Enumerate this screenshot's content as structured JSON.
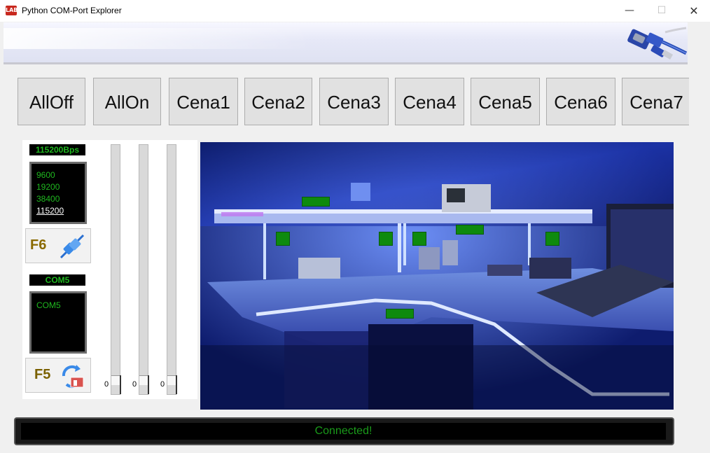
{
  "window": {
    "title": "Python COM-Port Explorer",
    "app_icon_text": "LAB",
    "minimize": "—",
    "maximize": "☐",
    "close": "✕"
  },
  "scenes": [
    "AllOff",
    "AllOn",
    "Cena1",
    "Cena2",
    "Cena3",
    "Cena4",
    "Cena5",
    "Cena6",
    "Cena7"
  ],
  "baud": {
    "label": "115200Bps",
    "options": [
      "9600",
      "19200",
      "38400",
      "115200"
    ],
    "selected": "115200"
  },
  "f6_button": {
    "label": "F6",
    "icon": "connect-plug-icon"
  },
  "com": {
    "label": "COM5",
    "options": [
      "COM5"
    ]
  },
  "f5_button": {
    "label": "F5",
    "icon": "refresh-icon"
  },
  "sliders": [
    {
      "value": "0"
    },
    {
      "value": "0"
    },
    {
      "value": "0"
    }
  ],
  "status": {
    "text": "Connected!"
  },
  "colors": {
    "terminal_green": "#1fb81f",
    "button_green": "#0e8a0e",
    "status_green": "#1a9a1a"
  }
}
